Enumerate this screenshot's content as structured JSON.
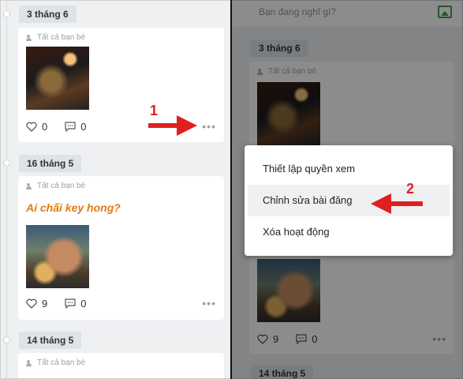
{
  "left": {
    "posts": [
      {
        "date": "3 tháng 6",
        "privacy": "Tất cả bạn bè",
        "likes": "0",
        "comments": "0"
      },
      {
        "date": "16 tháng 5",
        "privacy": "Tất cả bạn bè",
        "text": "Ai chấi key hong?",
        "likes": "9",
        "comments": "0"
      },
      {
        "date": "14 tháng 5",
        "privacy": "Tất cả bạn bè"
      }
    ],
    "step_number": "1"
  },
  "right": {
    "composer_placeholder": "Bạn đang nghĩ gì?",
    "posts": [
      {
        "date": "3 tháng 6",
        "privacy": "Tất cả bạn bè"
      },
      {
        "likes": "9",
        "comments": "0"
      },
      {
        "date": "14 tháng 5"
      }
    ],
    "menu": {
      "items": [
        "Thiết lập quyền xem",
        "Chỉnh sửa bài đăng",
        "Xóa hoạt động"
      ]
    },
    "step_number": "2"
  },
  "colors": {
    "accent_text": "#e07b14",
    "arrow": "#e02020",
    "image_icon": "#3aa14a"
  },
  "icons": [
    "friends-icon",
    "heart-icon",
    "comment-icon",
    "more-icon",
    "image-icon"
  ]
}
